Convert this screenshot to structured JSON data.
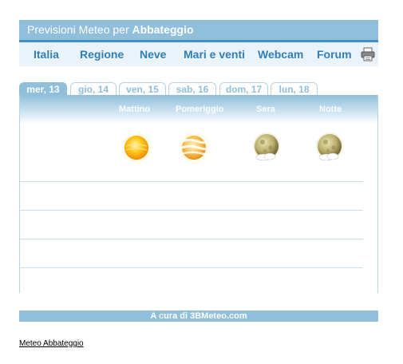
{
  "widget": {
    "title_prefix": "Previsioni Meteo per",
    "title_location": "Abbateggio"
  },
  "nav": {
    "items": [
      "Italia",
      "Regione",
      "Neve",
      "Mari e venti",
      "Webcam",
      "Forum"
    ],
    "print_icon": "printer-icon"
  },
  "tabs": [
    "mer, 13",
    "gio, 14",
    "ven, 15",
    "sab, 16",
    "dom, 17",
    "lun, 18"
  ],
  "active_tab": 0,
  "periods": [
    "Mattino",
    "Pomeriggio",
    "Sera",
    "Notte"
  ],
  "forecast_icons": [
    "sun-icon",
    "sun-hazy-icon",
    "moon-cloud-icon",
    "moon-cloud-icon"
  ],
  "footer": {
    "text": "A cura di 3BMeteo.com"
  },
  "bottom_link": "Meteo Abbateggio",
  "colors": {
    "accent": "#8fbfdb",
    "nav_text": "#2f7fb8",
    "dark_bar": "#3d8fc4"
  }
}
